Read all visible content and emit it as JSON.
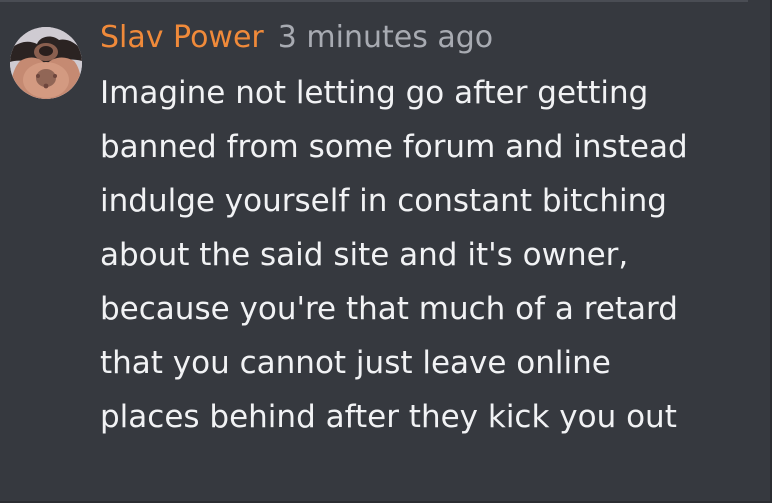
{
  "message": {
    "author": "Slav Power",
    "timestamp": "3 minutes ago",
    "avatar_icon": "user-avatar",
    "author_color": "#f08a3a",
    "timestamp_color": "#a8abb2",
    "text_color": "#f1f2f4",
    "background_color": "#36393f",
    "body": "Imagine not letting go after getting banned from some forum and instead indulge yourself in constant bitching about the said site and it's owner, because you're that much of a retard that you cannot just leave online places behind after they kick you out"
  }
}
